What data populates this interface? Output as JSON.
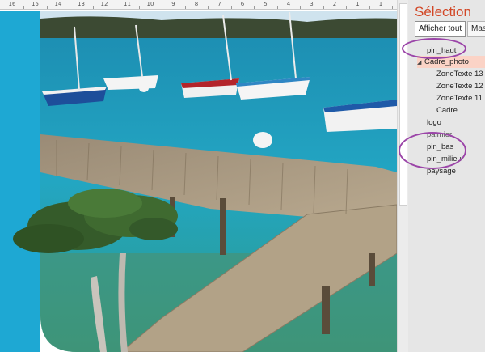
{
  "ruler": {
    "ticks": [
      "16",
      "15",
      "14",
      "13",
      "12",
      "11",
      "10",
      "9",
      "8",
      "7",
      "6",
      "5",
      "4",
      "3",
      "2",
      "1",
      "1"
    ]
  },
  "selection_pane": {
    "title": "Sélection",
    "show_all_label": "Afficher tout",
    "hide_all_label": "Masquer tout",
    "items": [
      {
        "label": "pin_haut"
      },
      {
        "label": "Cadre_photo"
      },
      {
        "label": "ZoneTexte 13"
      },
      {
        "label": "ZoneTexte 12"
      },
      {
        "label": "ZoneTexte 11"
      },
      {
        "label": "Cadre"
      },
      {
        "label": "logo"
      },
      {
        "label": "palmier"
      },
      {
        "label": "pin_bas"
      },
      {
        "label": "pin_milieu"
      },
      {
        "label": "paysage"
      }
    ]
  },
  "colors": {
    "accent_title": "#d24726",
    "selected_row": "#fbd3c6",
    "annotation_ring": "#9b45a8",
    "slide_blue": "#1ea8d3"
  }
}
